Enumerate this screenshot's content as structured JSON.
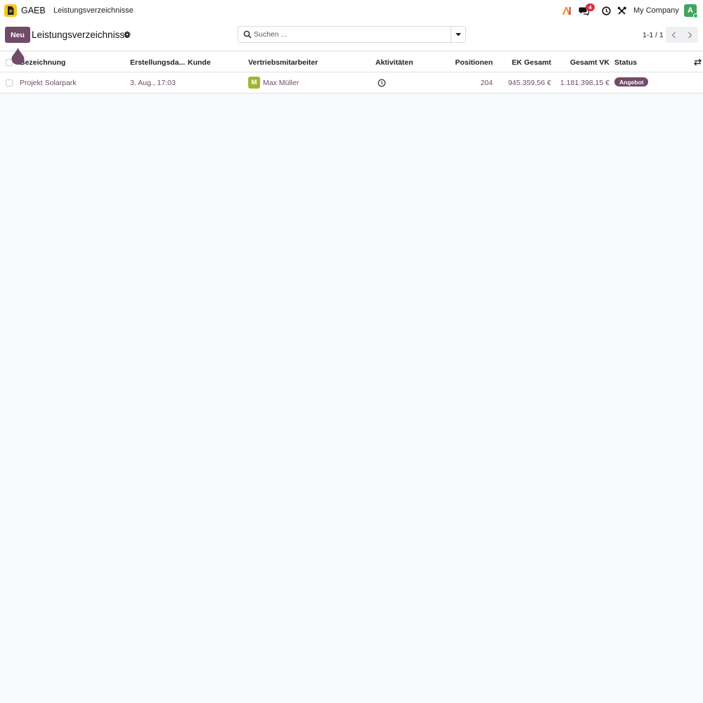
{
  "navbar": {
    "app_name": "GAEB",
    "menu_item": "Leistungsverzeichnisse",
    "messages_count": "4",
    "company": "My Company",
    "avatar_letter": "A"
  },
  "control_panel": {
    "new_button": "Neu",
    "title": "Leistungsverzeichnisse",
    "search_placeholder": "Suchen ...",
    "pager": "1-1 / 1"
  },
  "table": {
    "columns": [
      "Bezeichnung",
      "Erstellungsda...",
      "Kunde",
      "Vertriebsmitarbeiter",
      "Aktivitäten",
      "Positionen",
      "EK Gesamt",
      "Gesamt VK",
      "Status"
    ],
    "rows": [
      {
        "bezeichnung": "Projekt Solarpark",
        "erstellungsdatum": "3. Aug., 17:03",
        "kunde": "",
        "vertriebsmitarbeiter_initial": "M",
        "vertriebsmitarbeiter": "Max Müller",
        "positionen": "204",
        "ek_gesamt": "945.359,56 €",
        "gesamt_vk": "1.181.398,15 €",
        "status": "Angebot"
      }
    ]
  },
  "colors": {
    "primary": "#714b67",
    "app_logo": "#f7c71e",
    "badge": "#d9324b",
    "user_avatar": "#3fa460",
    "salesperson_avatar": "#a2b532"
  },
  "icons": [
    "document-icon",
    "ai-icon",
    "chat-icon",
    "clock-icon",
    "tools-icon",
    "gear-icon",
    "search-icon",
    "caret-down-icon",
    "chevron-left-icon",
    "chevron-right-icon",
    "activity-clock-icon",
    "column-toggle-icon"
  ]
}
